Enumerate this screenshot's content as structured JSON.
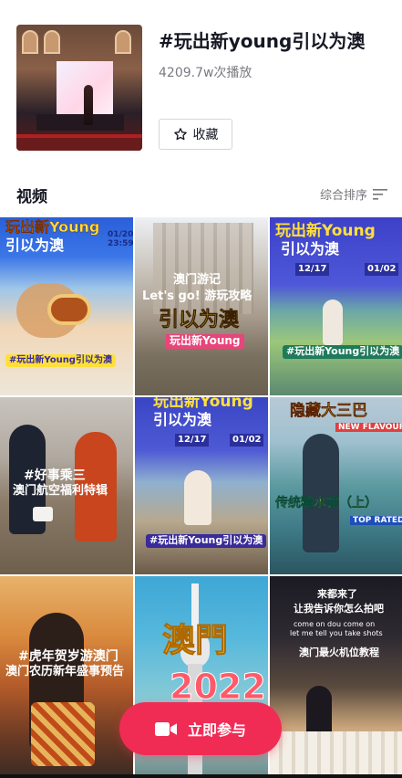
{
  "topic": {
    "title": "#玩出新young引以为澳",
    "play_count": "4209.7w次播放",
    "favorite_label": "收藏"
  },
  "section": {
    "title": "视频",
    "sort_label": "综合排序"
  },
  "videos": [
    {
      "lines": [
        "玩出新Young",
        "引以为澳",
        "01/20",
        "23:59",
        "#玩出新Young引以为澳"
      ]
    },
    {
      "lines": [
        "澳门游记",
        "Let's go! 游玩攻略",
        "引以为澳",
        "玩出新Young"
      ]
    },
    {
      "lines": [
        "玩出新Young",
        "引以为澳",
        "12/17",
        "01/02",
        "#玩出新Young引以为澳"
      ]
    },
    {
      "lines": [
        "#好事乘三",
        "澳门航空福利特辑"
      ]
    },
    {
      "lines": [
        "玩出新Young",
        "引以为澳",
        "12/17",
        "01/02",
        "#玩出新Young引以为澳"
      ]
    },
    {
      "lines": [
        "隐藏大三巴",
        "NEW FLAVOUR",
        "传统糖水铺（上）",
        "TOP RATED"
      ]
    },
    {
      "lines": [
        "#虎年贺岁游澳门",
        "澳门农历新年盛事预告"
      ]
    },
    {
      "lines": [
        "澳門",
        "2022"
      ]
    },
    {
      "lines": [
        "来都来了",
        "让我告诉你怎么拍吧",
        "come on dou come on",
        "let me tell you take shots",
        "澳门最火机位教程"
      ]
    }
  ],
  "cta": {
    "label": "立即参与"
  },
  "colors": {
    "accent": "#f02c55",
    "title_text": "#161823",
    "secondary_text": "#7a7b81",
    "caption_yellow": "#ffe03a"
  }
}
